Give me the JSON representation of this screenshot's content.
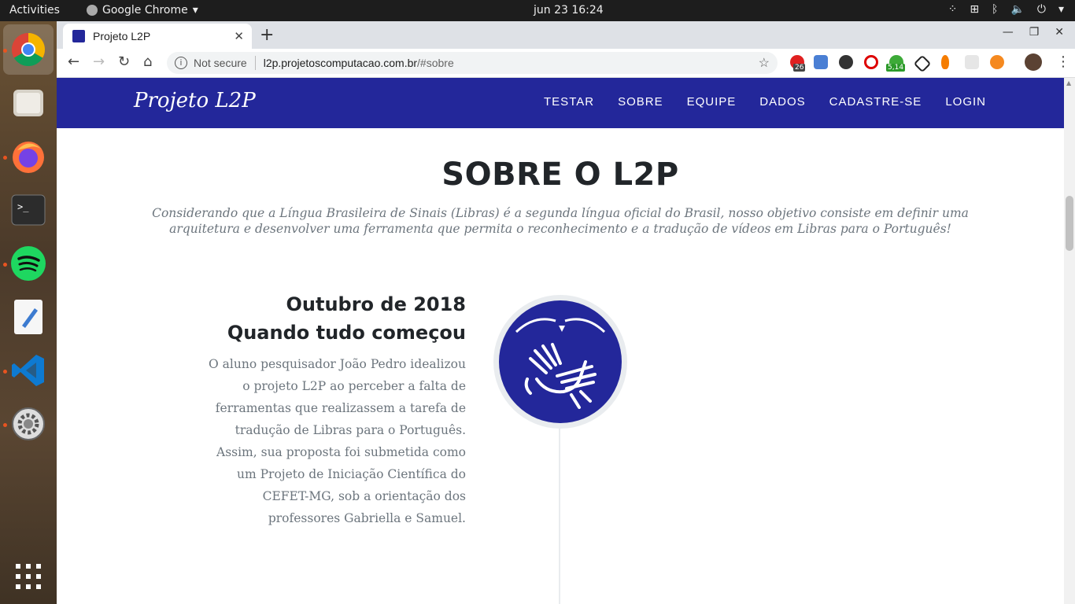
{
  "os": {
    "activities": "Activities",
    "app_name": "Google Chrome",
    "clock": "jun 23  16:24"
  },
  "browser": {
    "tab_title": "Projeto L2P",
    "security_label": "Not secure",
    "url_host": "l2p.projetoscomputacao.com.br",
    "url_path": "/#sobre",
    "extension_badges": [
      "26",
      "5,14"
    ]
  },
  "site": {
    "brand": "Projeto L2P",
    "nav": [
      "TESTAR",
      "SOBRE",
      "EQUIPE",
      "DADOS",
      "CADASTRE-SE",
      "LOGIN"
    ]
  },
  "about": {
    "title": "SOBRE O L2P",
    "subtitle": "Considerando que a Língua Brasileira de Sinais (Libras) é a segunda língua oficial do Brasil, nosso objetivo consiste em definir uma arquitetura e desenvolver uma ferramenta que permita o reconhecimento e a tradução de vídeos em Libras para o Português!"
  },
  "timeline": [
    {
      "date": "Outubro de 2018",
      "heading": "Quando tudo começou",
      "body": "O aluno pesquisador João Pedro idealizou o projeto L2P ao perceber a falta de ferramentas que realizassem a tarefa de tradução de Libras para o Português. Assim, sua proposta foi submetida como um Projeto de Iniciação Científica do CEFET-MG, sob a orientação dos professores Gabriella e Samuel."
    }
  ],
  "colors": {
    "brand": "#23279a",
    "heading": "#212529",
    "muted": "#6c757d"
  }
}
